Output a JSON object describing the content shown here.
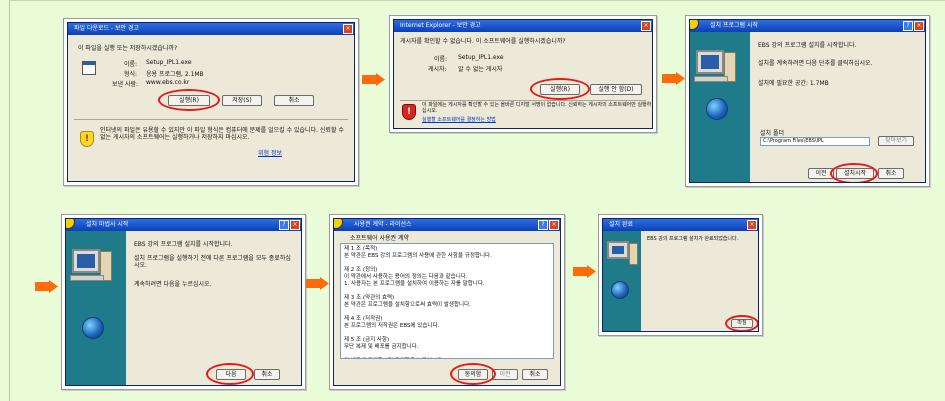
{
  "colors": {
    "page_bg": "#eafbd7",
    "arrow": "#ff6a0a",
    "highlight": "#e21b1b",
    "titlebar": "#0b3fb8"
  },
  "step1": {
    "title": "파일 다운로드 - 보안 경고",
    "question": "이 파일을 실행 또는 저장하시겠습니까?",
    "name_label": "이름:",
    "name_value": "Setup_IPL1.exe",
    "type_label": "형식:",
    "type_value": "응용 프로그램, 2.1MB",
    "from_label": "보낸 사람:",
    "from_value": "www.ebs.co.kr",
    "run_button": "실행(R)",
    "save_button": "저장(S)",
    "cancel_button": "취소",
    "warning": "인터넷의 파일은 유용할 수 있지만 이 파일 형식은 컴퓨터에 문제를 일으킬 수 있습니다. 신뢰할 수 없는 게시자의 소프트웨어는 실행하거나 저장하지 마십시오.",
    "risk_link": "위험 정보"
  },
  "step2": {
    "title": "Internet Explorer - 보안 경고",
    "question": "게시자를 확인할 수 없습니다. 이 소프트웨어를 실행하시겠습니까?",
    "name_label": "이름:",
    "name_value": "Setup_IPL1.exe",
    "publisher_label": "게시자:",
    "publisher_value": "알 수 없는 게시자",
    "run_button": "실행(R)",
    "no_run_button": "실행 안 함(D)",
    "warning": "이 파일에는 게시자를 확인할 수 있는 올바른 디지털 서명이 없습니다. 신뢰하는 게시자의 소프트웨어만 실행하십시오.",
    "link": "실행할 소프트웨어를 결정하는 방법"
  },
  "step3": {
    "title": "설치 프로그램 시작",
    "line1": "EBS 강의 프로그램 설치를 시작합니다.",
    "line2": "설치를 계속하려면 다음 단추를 클릭하십시오.",
    "line3": "설치에 필요한 공간: 1.7MB",
    "folder_label": "설치 폴더",
    "folder_path": "C:\\Program Files\\EBS\\IPL",
    "browse_button": "찾아보기",
    "back_button": "이전",
    "install_button": "설치시작",
    "cancel_button": "취소"
  },
  "step4": {
    "title": "설치 마법사 시작",
    "line1": "EBS 강의 프로그램 설치를 시작합니다.",
    "line2": "설치 프로그램을 실행하기 전에 다른 프로그램을 모두 종료하십시오.",
    "line3": "계속하려면 다음을 누르십시오.",
    "next_button": "다음",
    "cancel_button": "취소"
  },
  "step5": {
    "title": "사용권 계약 - 라이선스",
    "heading": "소프트웨어 사용권 계약",
    "body": "제 1 조 (목적)\n본 약관은 EBS 강의 프로그램의 사용에 관한 사항을 규정합니다.\n\n제 2 조 (정의)\n이 약관에서 사용하는 용어의 정의는 다음과 같습니다.\n1. 사용자는 본 프로그램을 설치하여 이용하는 자를 말합니다.\n\n제 3 조 (약관의 효력)\n본 약관은 프로그램을 설치함으로써 효력이 발생합니다.\n\n제 4 조 (저작권)\n본 프로그램의 저작권은 EBS에 있습니다.\n\n제 5 조 (금지 사항)\n무단 복제 및 배포를 금지합니다.\n\n위 내용에 동의하시면 동의함을 누르십시오.",
    "agree_button": "동의함",
    "back_button": "이전",
    "cancel_button": "취소"
  },
  "step6": {
    "title": "설치 완료",
    "line1": "EBS 강의 프로그램 설치가 완료되었습니다.",
    "finish_button": "마침"
  }
}
